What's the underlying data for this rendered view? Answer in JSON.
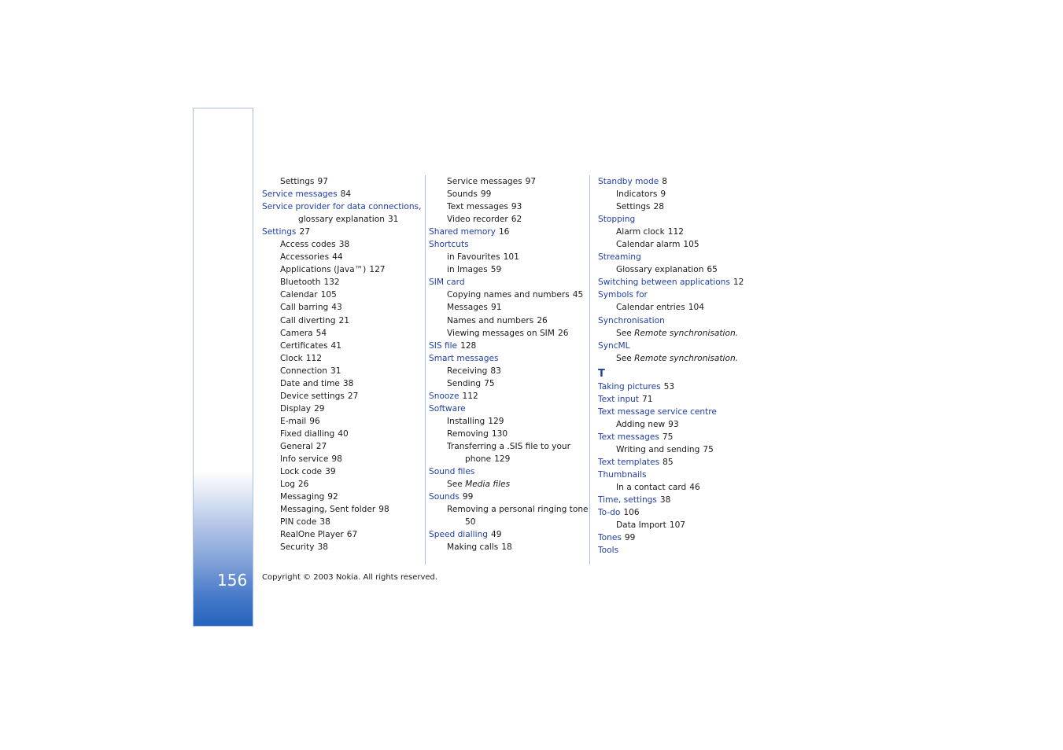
{
  "page_number": "156",
  "footer": "Copyright © 2003 Nokia. All rights reserved.",
  "see_label": "See",
  "columns": [
    [
      {
        "t": "sub",
        "text": "Settings",
        "num": "97"
      },
      {
        "t": "main",
        "text": "Service messages",
        "num": "84"
      },
      {
        "t": "main",
        "text": "Service provider for data connections,",
        "num": ""
      },
      {
        "t": "cont",
        "text": "glossary explanation",
        "num": "31"
      },
      {
        "t": "main",
        "text": "Settings",
        "num": "27"
      },
      {
        "t": "sub",
        "text": "Access codes",
        "num": "38"
      },
      {
        "t": "sub",
        "text": "Accessories",
        "num": "44"
      },
      {
        "t": "sub",
        "text": "Applications (Java™)",
        "num": "127"
      },
      {
        "t": "sub",
        "text": "Bluetooth",
        "num": "132"
      },
      {
        "t": "sub",
        "text": "Calendar",
        "num": "105"
      },
      {
        "t": "sub",
        "text": "Call barring",
        "num": "43"
      },
      {
        "t": "sub",
        "text": "Call diverting",
        "num": "21"
      },
      {
        "t": "sub",
        "text": "Camera",
        "num": "54"
      },
      {
        "t": "sub",
        "text": "Certificates",
        "num": "41"
      },
      {
        "t": "sub",
        "text": "Clock",
        "num": "112"
      },
      {
        "t": "sub",
        "text": "Connection",
        "num": "31"
      },
      {
        "t": "sub",
        "text": "Date and time",
        "num": "38"
      },
      {
        "t": "sub",
        "text": "Device settings",
        "num": "27"
      },
      {
        "t": "sub",
        "text": "Display",
        "num": "29"
      },
      {
        "t": "sub",
        "text": "E-mail",
        "num": "96"
      },
      {
        "t": "sub",
        "text": "Fixed dialling",
        "num": "40"
      },
      {
        "t": "sub",
        "text": "General",
        "num": "27"
      },
      {
        "t": "sub",
        "text": "Info service",
        "num": "98"
      },
      {
        "t": "sub",
        "text": "Lock code",
        "num": "39"
      },
      {
        "t": "sub",
        "text": "Log",
        "num": "26"
      },
      {
        "t": "sub",
        "text": "Messaging",
        "num": "92"
      },
      {
        "t": "sub",
        "text": "Messaging, Sent folder",
        "num": "98"
      },
      {
        "t": "sub",
        "text": "PIN code",
        "num": "38"
      },
      {
        "t": "sub",
        "text": "RealOne Player",
        "num": "67"
      },
      {
        "t": "sub",
        "text": "Security",
        "num": "38"
      }
    ],
    [
      {
        "t": "sub",
        "text": "Service messages",
        "num": "97"
      },
      {
        "t": "sub",
        "text": "Sounds",
        "num": "99"
      },
      {
        "t": "sub",
        "text": "Text messages",
        "num": "93"
      },
      {
        "t": "sub",
        "text": "Video recorder",
        "num": "62"
      },
      {
        "t": "main",
        "text": "Shared memory",
        "num": "16"
      },
      {
        "t": "main",
        "text": "Shortcuts",
        "num": ""
      },
      {
        "t": "sub",
        "text": "in Favourites",
        "num": "101"
      },
      {
        "t": "sub",
        "text": "in Images",
        "num": "59"
      },
      {
        "t": "main",
        "text": "SIM card",
        "num": ""
      },
      {
        "t": "sub",
        "text": "Copying names and numbers",
        "num": "45"
      },
      {
        "t": "sub",
        "text": "Messages",
        "num": "91"
      },
      {
        "t": "sub",
        "text": "Names and numbers",
        "num": "26"
      },
      {
        "t": "sub",
        "text": "Viewing messages on SIM",
        "num": "26"
      },
      {
        "t": "main",
        "text": "SIS file",
        "num": "128"
      },
      {
        "t": "main",
        "text": "Smart messages",
        "num": ""
      },
      {
        "t": "sub",
        "text": "Receiving",
        "num": "83"
      },
      {
        "t": "sub",
        "text": "Sending",
        "num": "75"
      },
      {
        "t": "main",
        "text": "Snooze",
        "num": "112"
      },
      {
        "t": "main",
        "text": "Software",
        "num": ""
      },
      {
        "t": "sub",
        "text": "Installing",
        "num": "129"
      },
      {
        "t": "sub",
        "text": "Removing",
        "num": "130"
      },
      {
        "t": "sub",
        "text": "Transferring a .SIS file to your",
        "num": ""
      },
      {
        "t": "cont",
        "text": "phone",
        "num": "129"
      },
      {
        "t": "main",
        "text": "Sound files",
        "num": ""
      },
      {
        "t": "see",
        "text": "Media files",
        "num": ""
      },
      {
        "t": "main",
        "text": "Sounds",
        "num": "99"
      },
      {
        "t": "sub",
        "text": "Removing a personal ringing tone",
        "num": ""
      },
      {
        "t": "cont",
        "text": "",
        "num": "50"
      },
      {
        "t": "main",
        "text": "Speed dialling",
        "num": "49"
      },
      {
        "t": "sub",
        "text": "Making calls",
        "num": "18"
      }
    ],
    [
      {
        "t": "main",
        "text": "Standby mode",
        "num": "8"
      },
      {
        "t": "sub",
        "text": "Indicators",
        "num": "9"
      },
      {
        "t": "sub",
        "text": "Settings",
        "num": "28"
      },
      {
        "t": "main",
        "text": "Stopping",
        "num": ""
      },
      {
        "t": "sub",
        "text": "Alarm clock",
        "num": "112"
      },
      {
        "t": "sub",
        "text": "Calendar alarm",
        "num": "105"
      },
      {
        "t": "main",
        "text": "Streaming",
        "num": ""
      },
      {
        "t": "sub",
        "text": "Glossary explanation",
        "num": "65"
      },
      {
        "t": "main",
        "text": "Switching between applications",
        "num": "12"
      },
      {
        "t": "main",
        "text": "Symbols for",
        "num": ""
      },
      {
        "t": "sub",
        "text": "Calendar entries",
        "num": "104"
      },
      {
        "t": "main",
        "text": "Synchronisation",
        "num": ""
      },
      {
        "t": "see",
        "text": "Remote synchronisation.",
        "num": ""
      },
      {
        "t": "main",
        "text": "SyncML",
        "num": ""
      },
      {
        "t": "see",
        "text": "Remote synchronisation.",
        "num": ""
      },
      {
        "t": "letter",
        "text": "T",
        "num": ""
      },
      {
        "t": "main",
        "text": "Taking pictures",
        "num": "53"
      },
      {
        "t": "main",
        "text": "Text input",
        "num": "71"
      },
      {
        "t": "main",
        "text": "Text message service centre",
        "num": ""
      },
      {
        "t": "sub",
        "text": "Adding new",
        "num": "93"
      },
      {
        "t": "main",
        "text": "Text messages",
        "num": "75"
      },
      {
        "t": "sub",
        "text": "Writing and sending",
        "num": "75"
      },
      {
        "t": "main",
        "text": "Text templates",
        "num": "85"
      },
      {
        "t": "main",
        "text": "Thumbnails",
        "num": ""
      },
      {
        "t": "sub",
        "text": "In a contact card",
        "num": "46"
      },
      {
        "t": "main",
        "text": "Time, settings",
        "num": "38"
      },
      {
        "t": "main",
        "text": "To-do",
        "num": "106"
      },
      {
        "t": "sub",
        "text": "Data Import",
        "num": "107"
      },
      {
        "t": "main",
        "text": "Tones",
        "num": "99"
      },
      {
        "t": "main",
        "text": "Tools",
        "num": ""
      }
    ]
  ]
}
